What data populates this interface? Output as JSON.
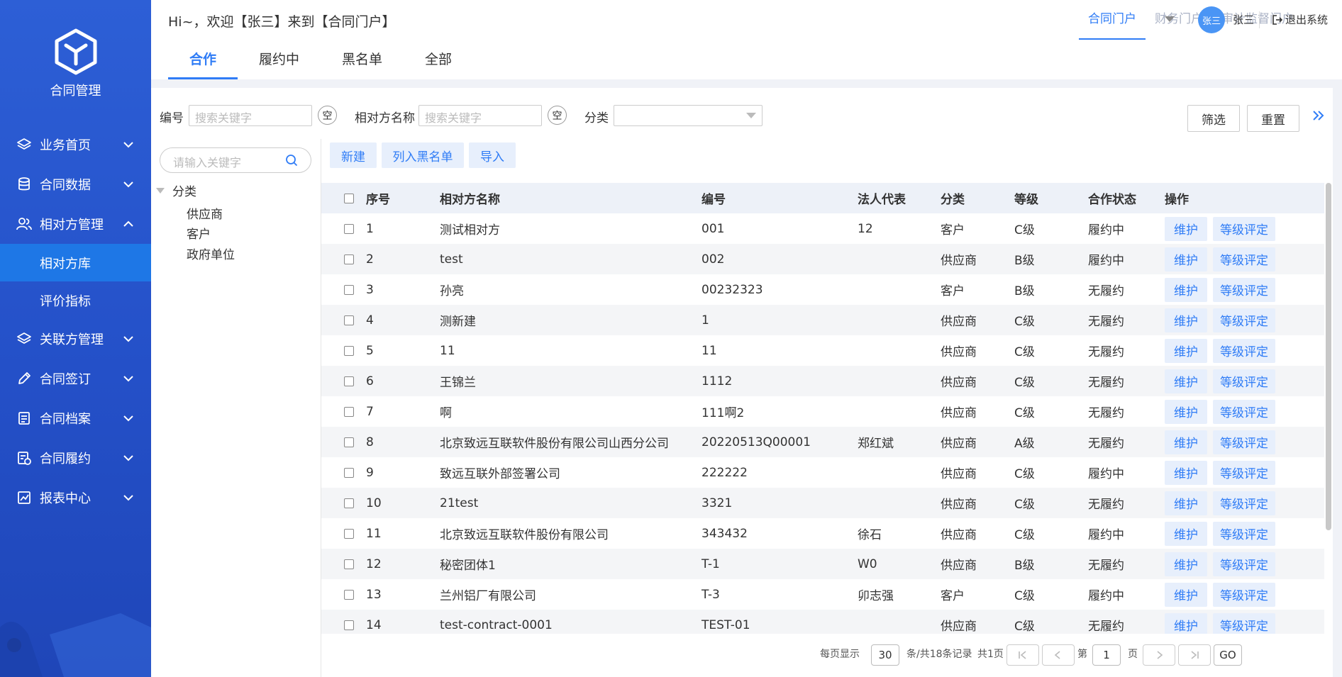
{
  "sidebar": {
    "logo_title": "合同管理",
    "menu": [
      {
        "label": "业务首页",
        "icon": "layers-icon",
        "expanded": false
      },
      {
        "label": "合同数据",
        "icon": "database-icon",
        "expanded": false
      },
      {
        "label": "相对方管理",
        "icon": "users-icon",
        "expanded": true,
        "children": [
          {
            "label": "相对方库",
            "active": true
          },
          {
            "label": "评价指标",
            "active": false
          }
        ]
      },
      {
        "label": "关联方管理",
        "icon": "layers-icon",
        "expanded": false
      },
      {
        "label": "合同签订",
        "icon": "pen-icon",
        "expanded": false
      },
      {
        "label": "合同档案",
        "icon": "archive-icon",
        "expanded": false
      },
      {
        "label": "合同履约",
        "icon": "document-check-icon",
        "expanded": false
      },
      {
        "label": "报表中心",
        "icon": "chart-icon",
        "expanded": false
      }
    ]
  },
  "header": {
    "welcome": "Hi~，欢迎【张三】来到【合同门户】",
    "portals": [
      "合同门户",
      "财务门户",
      "审计监督门户"
    ],
    "active_portal": 0,
    "avatar_text": "张三",
    "username": "张三",
    "logout": "退出系统"
  },
  "tabs": [
    "合作",
    "履约中",
    "黑名单",
    "全部"
  ],
  "filters": {
    "code_label": "编号",
    "code_placeholder": "搜索关键字",
    "name_label": "相对方名称",
    "name_placeholder": "搜索关键字",
    "clear_label": "空",
    "category_label": "分类",
    "filter_button": "筛选",
    "reset_button": "重置"
  },
  "tree": {
    "search_placeholder": "请输入关键字",
    "root": "分类",
    "children": [
      "供应商",
      "客户",
      "政府单位"
    ]
  },
  "actions": [
    "新建",
    "列入黑名单",
    "导入"
  ],
  "table": {
    "headers": [
      "序号",
      "相对方名称",
      "编号",
      "法人代表",
      "分类",
      "等级",
      "合作状态",
      "操作"
    ],
    "op_labels": [
      "维护",
      "等级评定"
    ],
    "rows": [
      [
        "1",
        "测试相对方",
        "001",
        "12",
        "客户",
        "C级",
        "履约中"
      ],
      [
        "2",
        "test",
        "002",
        "",
        "供应商",
        "B级",
        "履约中"
      ],
      [
        "3",
        "孙亮",
        "00232323",
        "",
        "客户",
        "B级",
        "无履约"
      ],
      [
        "4",
        "测新建",
        "1",
        "",
        "供应商",
        "C级",
        "无履约"
      ],
      [
        "5",
        "11",
        "11",
        "",
        "供应商",
        "C级",
        "无履约"
      ],
      [
        "6",
        "王锦兰",
        "1112",
        "",
        "供应商",
        "C级",
        "无履约"
      ],
      [
        "7",
        "啊",
        "111啊2",
        "",
        "供应商",
        "C级",
        "无履约"
      ],
      [
        "8",
        "北京致远互联软件股份有限公司山西分公司",
        "20220513Q00001",
        "郑红斌",
        "供应商",
        "A级",
        "无履约"
      ],
      [
        "9",
        "致远互联外部签署公司",
        "222222",
        "",
        "供应商",
        "C级",
        "履约中"
      ],
      [
        "10",
        "21test",
        "3321",
        "",
        "供应商",
        "C级",
        "无履约"
      ],
      [
        "11",
        "北京致远互联软件股份有限公司",
        "343432",
        "徐石",
        "供应商",
        "C级",
        "履约中"
      ],
      [
        "12",
        "秘密团体1",
        "T-1",
        "W0",
        "供应商",
        "B级",
        "无履约"
      ],
      [
        "13",
        "兰州铝厂有限公司",
        "T-3",
        "卯志强",
        "客户",
        "C级",
        "履约中"
      ],
      [
        "14",
        "test-contract-0001",
        "TEST-01",
        "",
        "供应商",
        "C级",
        "无履约"
      ]
    ]
  },
  "pagination": {
    "per_page_label": "每页显示",
    "per_page": "30",
    "total_label": "条/共18条记录",
    "pages_label": "共1页",
    "page_prefix": "第",
    "page": "1",
    "page_suffix": "页",
    "go": "GO"
  },
  "colors": {
    "accent": "#2f7cf6",
    "sidebar": "#2450c8",
    "active_sub": "#1e77e6"
  }
}
